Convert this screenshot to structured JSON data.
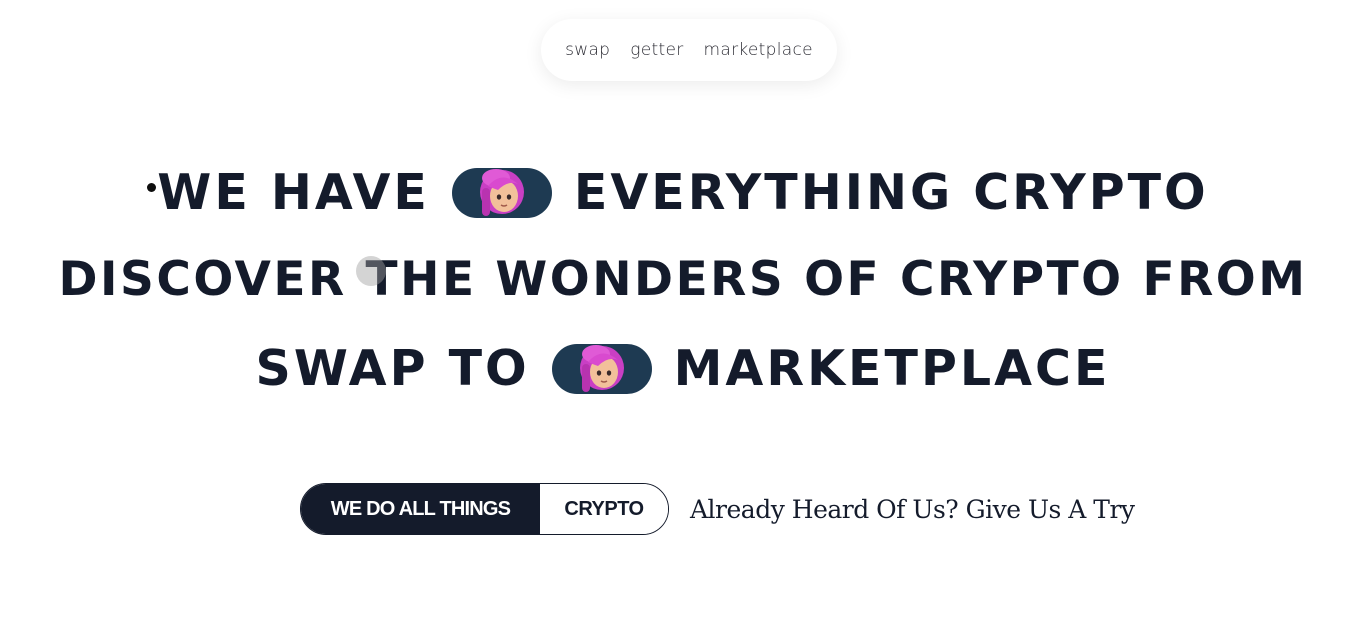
{
  "nav": {
    "items": [
      {
        "label": "swap"
      },
      {
        "label": "getter"
      },
      {
        "label": "marketplace"
      }
    ]
  },
  "headline": {
    "line1": {
      "before": "WE HAVE",
      "after": "EVERYTHING CRYPTO"
    },
    "line2": {
      "text": "DISCOVER THE WONDERS OF CRYPTO FROM"
    },
    "line3": {
      "before": "SWAP TO",
      "after": "MARKETPLACE"
    },
    "avatar_icon": "avatar-girl-pink-hair"
  },
  "cta": {
    "primary_label": "WE DO ALL THINGS",
    "secondary_label": "CRYPTO",
    "tagline": "Already Heard Of Us? Give Us A Try"
  },
  "colors": {
    "text": "#141b2b",
    "avatar_bg": "#1e3a52",
    "hair": "#c93fc4",
    "background": "#ffffff"
  }
}
